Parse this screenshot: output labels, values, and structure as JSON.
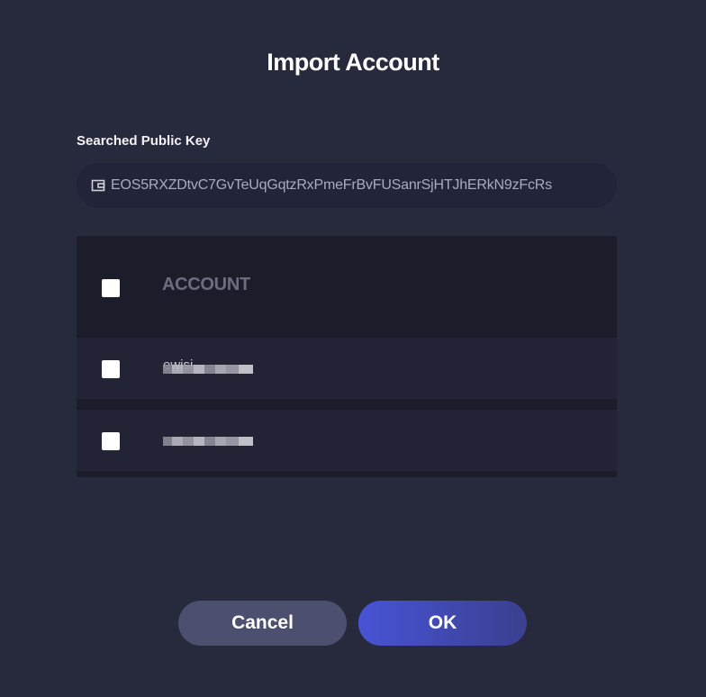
{
  "dialog": {
    "title": "Import Account",
    "public_key_label": "Searched Public Key",
    "public_key_value": "EOS5RXZDtvC7GvTeUqGqtzRxPmeFrBvFUSanrSjHTJhERkN9zFcRs",
    "public_key_icon": "wallet-icon"
  },
  "table": {
    "column_header": "ACCOUNT",
    "rows": [
      {
        "account_name": "ewisi",
        "checked": false,
        "obscured": true
      },
      {
        "account_name": "",
        "checked": false,
        "obscured": true
      }
    ],
    "select_all_checked": false
  },
  "buttons": {
    "cancel_label": "Cancel",
    "ok_label": "OK"
  },
  "colors": {
    "background": "#272a3d",
    "field_background": "#22253a",
    "table_header": "#1c1d2b",
    "table_row": "#222436",
    "cancel_button": "#4c4f6d",
    "ok_button_start": "#4754d6",
    "ok_button_end": "#3b3f8e",
    "muted_text": "#6c6e80"
  }
}
